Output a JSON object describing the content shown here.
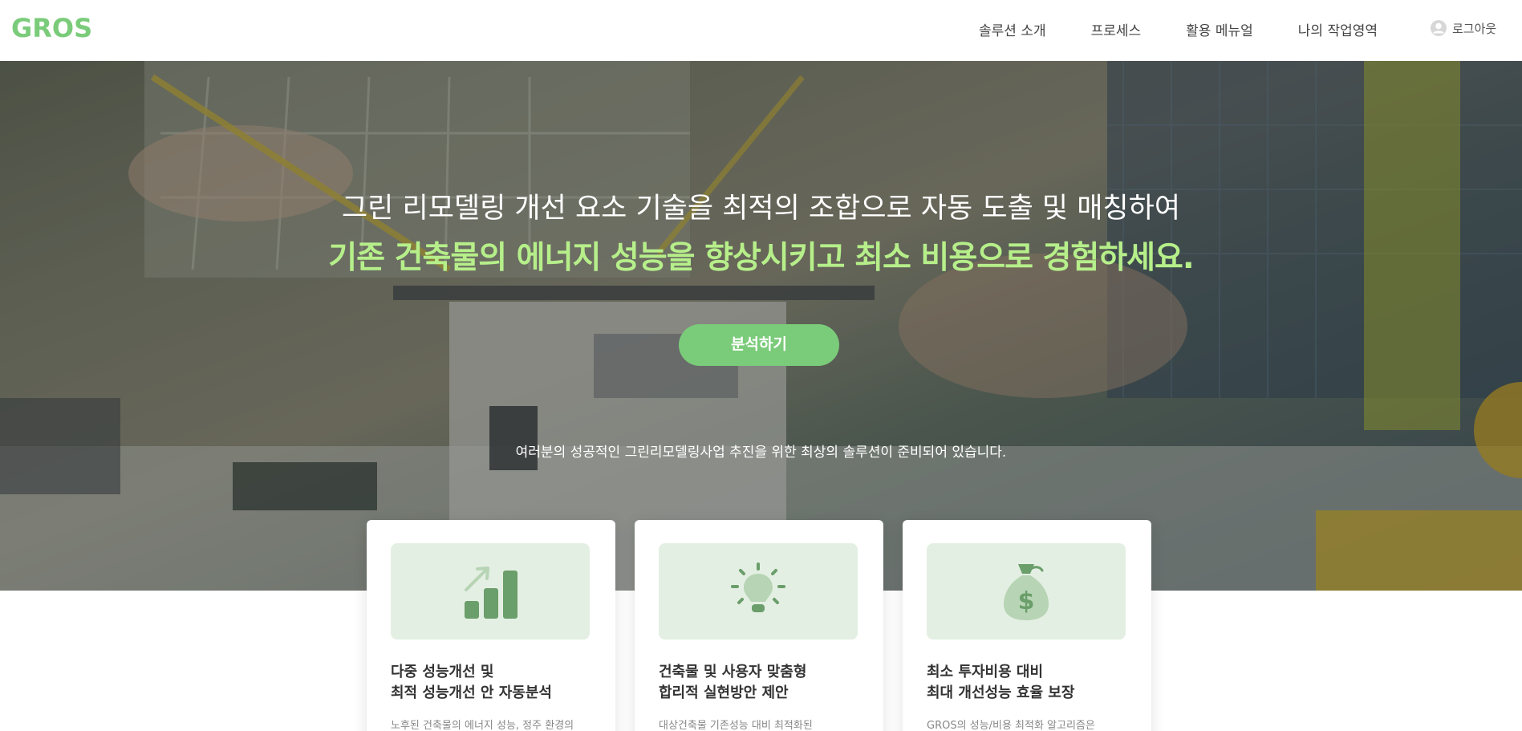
{
  "header": {
    "logo": "GROS",
    "nav": [
      "솔루션 소개",
      "프로세스",
      "활용 메뉴얼",
      "나의 작업영역"
    ],
    "logout_label": "로그아웃"
  },
  "hero": {
    "line1": "그린 리모델링 개선 요소 기술을 최적의 조합으로 자동 도출 및 매칭하여",
    "line2": "기존 건축물의 에너지 성능을 향상시키고 최소 비용으로 경험하세요.",
    "cta_label": "분석하기",
    "subtext": "여러분의 성공적인 그린리모델링사업 추진을 위한 최상의 솔루션이 준비되어 있습니다."
  },
  "cards": [
    {
      "icon": "bar-chart-growth-icon",
      "title_line1": "다중 성능개선 및",
      "title_line2": "최적 성능개선 안 자동분석",
      "desc": "노후된 건축물의 에너지 성능, 정주 환경의"
    },
    {
      "icon": "lightbulb-icon",
      "title_line1": "건축물 및 사용자 맞춤형",
      "title_line2": "합리적 실현방안 제안",
      "desc": "대상건축물 기존성능 대비 최적화된"
    },
    {
      "icon": "money-bag-icon",
      "title_line1": "최소 투자비용 대비",
      "title_line2": "최대 개선성능 효율 보장",
      "desc": "GROS의 성능/비용 최적화 알고리즘은"
    }
  ],
  "colors": {
    "brand": "#7acb7a",
    "highlight": "#b6ef8a",
    "icon": "#6a9e6a",
    "card_media_bg": "#e4efe3"
  }
}
